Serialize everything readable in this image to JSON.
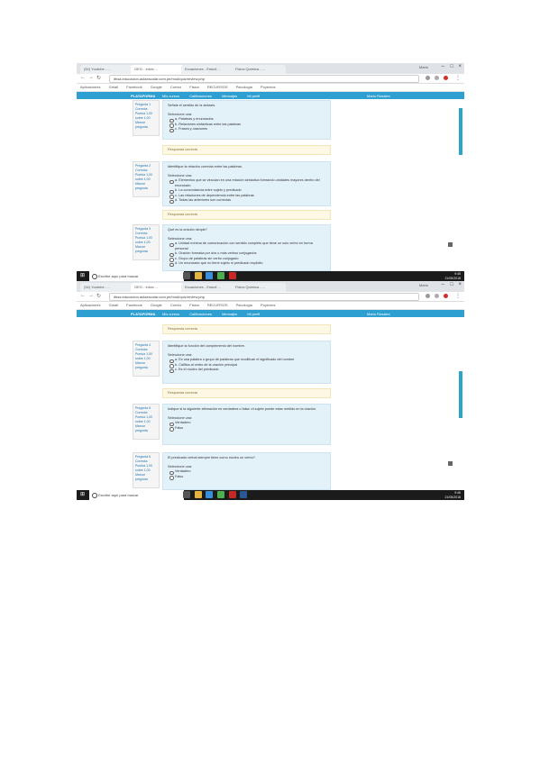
{
  "shot1": {
    "tabs": [
      "(54) Youtube - ...",
      "GEO - Inicio ...",
      "Ecuaciones - Estudi ...",
      "Fisica Quimica - ..."
    ],
    "user": "Mario",
    "url": "ithsa.educacion.aulaescolar.com.pe/mod/quiz/review.php",
    "bookmarks": [
      "Aplicaciones",
      "Gmail",
      "Facebook",
      "Google",
      "Correo",
      "Fisica",
      "RECURSOS",
      "Psicologia",
      "Poyectos"
    ],
    "site": {
      "brand": "PLATAFORMA",
      "links": [
        "Mis cursos",
        "Calificaciones",
        "Mensajes",
        "Mi perfil"
      ],
      "me": "Mario Rosales"
    },
    "questions": [
      {
        "info": [
          "Pregunta 1",
          "Correcta",
          "Puntúa 1,00",
          "sobre 1,00",
          "Marcar pregunta"
        ],
        "text": "Señale el sentido de la sintaxis.",
        "select": "Seleccione una:",
        "options": [
          "a. Palabras y enunciados",
          "b. Relaciones sintácticas entre las palabras",
          "c. Frases y oraciones"
        ],
        "feedback": "Respuesta correcta"
      },
      {
        "info": [
          "Pregunta 2",
          "Correcta",
          "Puntúa 1,00",
          "sobre 1,00",
          "Marcar pregunta"
        ],
        "text": "Identifique la relación correcta entre las palabras.",
        "select": "Seleccione una:",
        "options": [
          "a. Elementos que se vinculan en una relación sintáctica formando unidades mayores dentro del enunciado",
          "b. La concordancia entre sujeto y predicado",
          "c. Las relaciones de dependencia entre las palabras",
          "d. Todas las anteriores son correctas"
        ],
        "feedback": "Respuesta correcta"
      },
      {
        "info": [
          "Pregunta 3",
          "Correcta",
          "Puntúa 1,00",
          "sobre 1,00",
          "Marcar pregunta"
        ],
        "text": "Qué es la oración simple?",
        "select": "Seleccione una:",
        "options": [
          "a. Unidad mínima de comunicación con sentido completo que tiene un solo verbo en forma personal",
          "b. Oración formada por dos o más verbos conjugados",
          "c. Grupo de palabras sin verbo conjugado",
          "d. Un enunciado que no tiene sujeto ni predicado explícito"
        ],
        "feedback": ""
      }
    ],
    "taskbar": {
      "search": "Escribe aquí para buscar",
      "time": "9:45",
      "date": "21/05/2018"
    }
  },
  "shot2": {
    "tabs": [
      "(54) Youtube - ...",
      "GEO - Inicio ...",
      "Ecuaciones - Estudi ...",
      "Fisica Quimica - ..."
    ],
    "user": "Mario",
    "url": "ithsa.educacion.aulaescolar.com.pe/mod/quiz/review.php",
    "bookmarks": [
      "Aplicaciones",
      "Gmail",
      "Facebook",
      "Google",
      "Correo",
      "Fisica",
      "RECURSOS",
      "Psicologia",
      "Poyectos"
    ],
    "site": {
      "brand": "PLATAFORMA",
      "links": [
        "Mis cursos",
        "Calificaciones",
        "Mensajes",
        "Mi perfil"
      ],
      "me": "Mario Rosales"
    },
    "topFeedback": "Respuesta correcta",
    "questions": [
      {
        "info": [
          "Pregunta 4",
          "Correcta",
          "Puntúa 1,00",
          "sobre 1,00",
          "Marcar pregunta"
        ],
        "text": "Identifique la función del complemento del nombre.",
        "select": "Seleccione una:",
        "options": [
          "a. Es una palabra o grupo de palabras que modifican el significado del nombre",
          "b. Califica al verbo de la oración principal",
          "c. Es el núcleo del predicado"
        ],
        "feedback": "Respuesta correcta"
      },
      {
        "info": [
          "Pregunta 5",
          "Correcta",
          "Puntúa 1,00",
          "sobre 1,00",
          "Marcar pregunta"
        ],
        "text": "Indique si la siguiente afirmación es verdadera o falsa: el sujeto puede estar omitido en la oración.",
        "select": "Seleccione una:",
        "options": [
          "Verdadero",
          "Falso"
        ],
        "feedback": ""
      },
      {
        "info": [
          "Pregunta 6",
          "Correcta",
          "Puntúa 1,00",
          "sobre 1,00",
          "Marcar pregunta"
        ],
        "text": "El predicado verbal siempre tiene como núcleo un verbo?",
        "select": "Seleccione una:",
        "options": [
          "Verdadero",
          "Falso"
        ],
        "feedback": ""
      }
    ],
    "taskbar": {
      "search": "Escribe aquí para buscar",
      "time": "9:46",
      "date": "21/05/2018"
    }
  },
  "colors": {
    "accent": "#2e9fd1",
    "question_bg": "#e3f1f9",
    "feedback_bg": "#fcf8e3",
    "taskbar": "#1b1b1b"
  }
}
